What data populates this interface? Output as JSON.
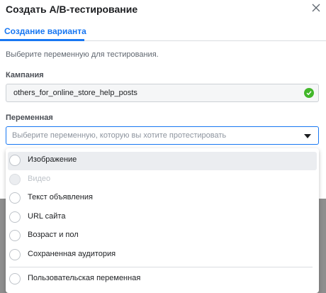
{
  "dialog": {
    "title": "Создать A/B-тестирование",
    "close_icon": "close-icon"
  },
  "tabs": [
    {
      "label": "Создание варианта",
      "active": true
    }
  ],
  "instruction": "Выберите переменную для тестирования.",
  "campaign": {
    "label": "Кампания",
    "value": "others_for_online_store_help_posts",
    "status_icon": "check-circle-icon",
    "status_color": "#42b72a"
  },
  "variable": {
    "label": "Переменная",
    "placeholder": "Выберите переменную, которую вы хотите протестировать",
    "caret_icon": "caret-down-icon",
    "options": [
      {
        "label": "Изображение",
        "highlighted": true,
        "disabled": false
      },
      {
        "label": "Видео",
        "highlighted": false,
        "disabled": true
      },
      {
        "label": "Текст объявления",
        "highlighted": false,
        "disabled": false
      },
      {
        "label": "URL сайта",
        "highlighted": false,
        "disabled": false
      },
      {
        "label": "Возраст и пол",
        "highlighted": false,
        "disabled": false
      },
      {
        "label": "Сохраненная аудитория",
        "highlighted": false,
        "disabled": false
      },
      {
        "label": "Пользовательская переменная",
        "highlighted": false,
        "disabled": false
      }
    ]
  },
  "colors": {
    "accent": "#1877f2",
    "success": "#42b72a"
  }
}
